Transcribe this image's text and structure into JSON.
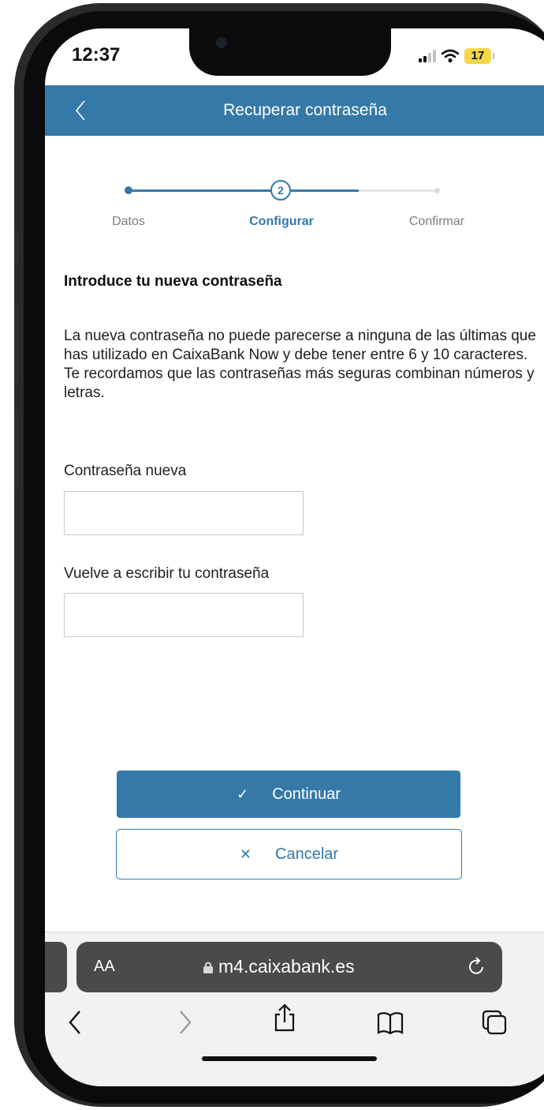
{
  "status_bar": {
    "time": "12:37",
    "battery": "17",
    "wifi_icon": "wifi-icon",
    "signal_icon": "signal-icon"
  },
  "header": {
    "title": "Recuperar contraseña",
    "back_icon": "chevron-left-icon",
    "background_color": "#3579a9"
  },
  "stepper": {
    "steps": [
      {
        "label": "Datos",
        "state": "done"
      },
      {
        "label": "Configurar",
        "state": "active",
        "number": "2"
      },
      {
        "label": "Confirmar",
        "state": "pending"
      }
    ]
  },
  "form": {
    "section_title": "Introduce tu nueva contraseña",
    "description": "La nueva contraseña no puede parecerse a ninguna de las últimas que has utilizado en CaixaBank Now y debe tener entre 6 y 10 caracteres. Te recordamos que las contraseñas más seguras combinan números y letras.",
    "fields": [
      {
        "label": "Contraseña nueva",
        "value": ""
      },
      {
        "label": "Vuelve a escribir tu contraseña",
        "value": ""
      }
    ]
  },
  "actions": {
    "continue_label": "Continuar",
    "continue_icon": "check-icon",
    "cancel_label": "Cancelar",
    "cancel_icon": "close-icon"
  },
  "browser": {
    "text_size_label": "AA",
    "url": "m4.caixabank.es",
    "toolbar_icons": [
      "back-icon",
      "forward-icon",
      "share-icon",
      "bookmarks-icon",
      "tabs-icon"
    ]
  },
  "colors": {
    "accent": "#3579a9",
    "url_bar": "#4a4a4c"
  }
}
